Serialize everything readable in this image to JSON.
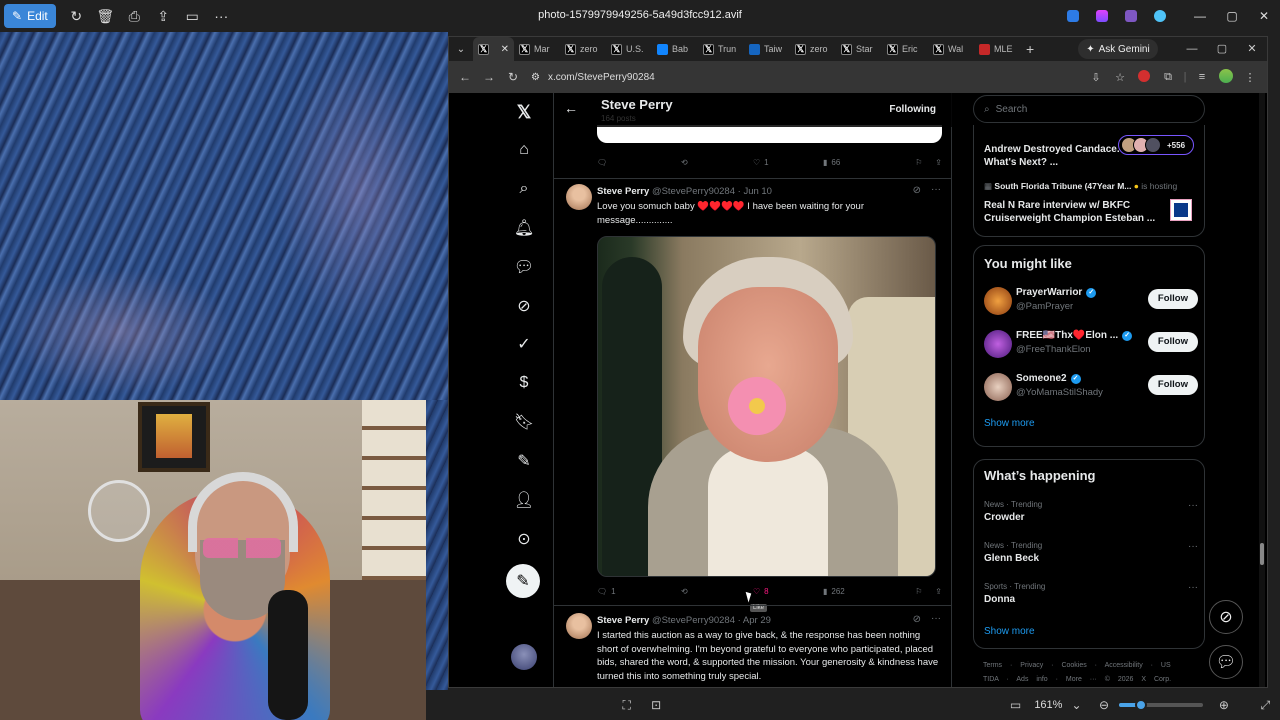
{
  "photos_app": {
    "edit_label": "Edit",
    "file_title": "photo-1579979949256-5a49d3fcc912.avif",
    "zoom_level": "161%",
    "zoom_slider_fraction": 0.25
  },
  "browser": {
    "tabs": [
      {
        "label": "",
        "favicon": "X",
        "active": true
      },
      {
        "label": "Mar",
        "favicon": "X"
      },
      {
        "label": "zero",
        "favicon": "X"
      },
      {
        "label": "U.S.",
        "favicon": "X"
      },
      {
        "label": "Bab",
        "favicon": "bluesky"
      },
      {
        "label": "Trun",
        "favicon": "X"
      },
      {
        "label": "Taiw",
        "favicon": "news"
      },
      {
        "label": "zero",
        "favicon": "X"
      },
      {
        "label": "Star",
        "favicon": "X"
      },
      {
        "label": "Eric",
        "favicon": "X"
      },
      {
        "label": "Wal",
        "favicon": "X"
      },
      {
        "label": "MLE",
        "favicon": "mail"
      }
    ],
    "gemini_label": "Ask Gemini",
    "url": "x.com/StevePerry90284"
  },
  "profile_header": {
    "name": "Steve Perry",
    "post_count": "164 posts",
    "following_label": "Following"
  },
  "prev_tweet_actions": {
    "replies": "",
    "reposts": "",
    "likes": "1",
    "views": "66"
  },
  "tweets": [
    {
      "name": "Steve Perry",
      "handle": "@StevePerry90284",
      "date": "· Jun 10",
      "text": "Love you somuch baby ♥️♥️♥️♥️ I have been waiting for your message..............",
      "replies": "1",
      "reposts": "",
      "likes": "8",
      "views": "262",
      "like_tooltip": "Like"
    },
    {
      "name": "Steve Perry",
      "handle": "@StevePerry90284",
      "date": "· Apr 29",
      "text": "I started this auction as a way to give back, & the response has been nothing short of overwhelming. I'm beyond grateful to everyone who participated, placed bids, shared the word, & supported the mission. Your generosity & kindness have turned this into something truly special."
    }
  ],
  "right_column": {
    "search_placeholder": "Search",
    "space": {
      "title": "Andrew Destroyed Candace. What's Next? ...",
      "listeners": "+556",
      "host_name": "South Florida Tribune (47Year M...",
      "host_suffix": "is hosting",
      "title2": "Real N Rare interview w/ BKFC Cruiserweight Champion Esteban ..."
    },
    "you_might_like": {
      "title": "You might like",
      "users": [
        {
          "name": "PrayerWarrior",
          "handle": "@PamPrayer",
          "button": "Follow"
        },
        {
          "name": "FREE🇺🇸Thx♥️Elon ...",
          "handle": "@FreeThankElon",
          "button": "Follow"
        },
        {
          "name": "Someone2",
          "handle": "@YoMamaStilShady",
          "button": "Follow"
        }
      ],
      "show_more": "Show more"
    },
    "whats_happening": {
      "title": "What’s happening",
      "trends": [
        {
          "meta": "News · Trending",
          "topic": "Crowder"
        },
        {
          "meta": "News · Trending",
          "topic": "Glenn Beck"
        },
        {
          "meta": "Sports · Trending",
          "topic": "Donna"
        }
      ],
      "show_more": "Show more"
    },
    "footer": "Terms · Privacy · Cookies · Accessibility · US TIDA · Ads info · More ··· © 2026 X Corp."
  }
}
